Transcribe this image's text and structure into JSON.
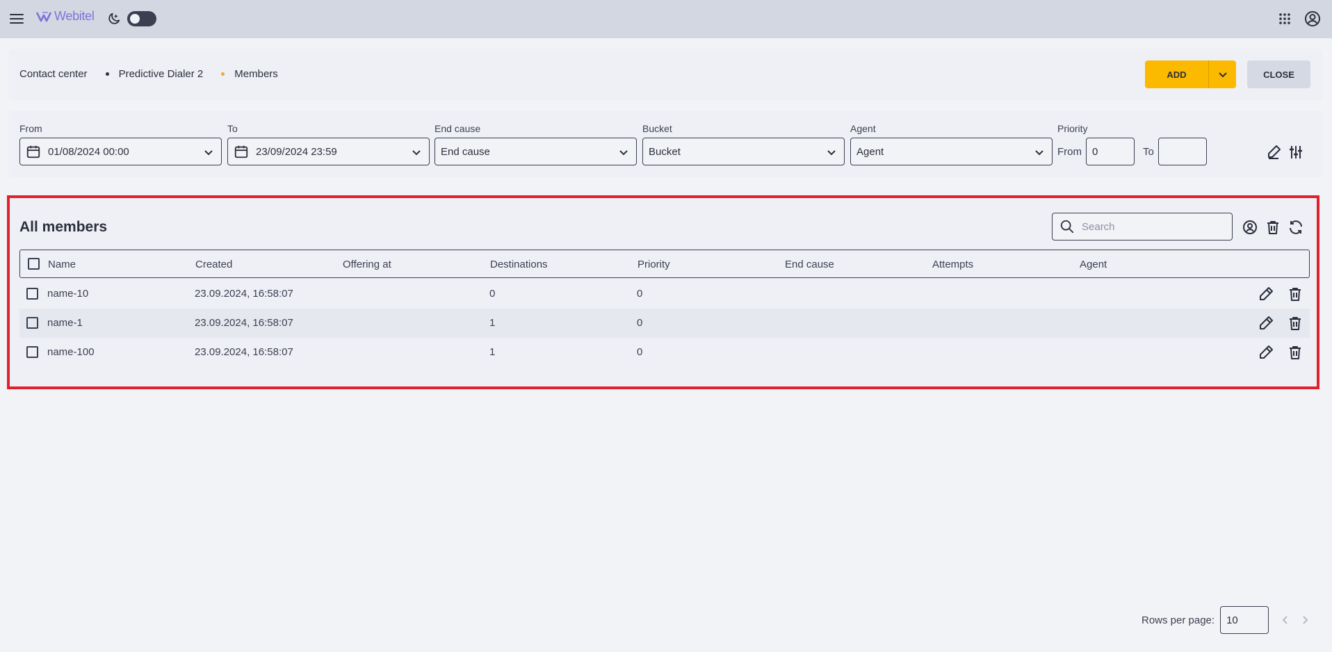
{
  "app": {
    "logo_text": "Webitel"
  },
  "breadcrumb": [
    "Contact center",
    "Predictive Dialer 2",
    "Members"
  ],
  "actions": {
    "add_label": "ADD",
    "close_label": "CLOSE"
  },
  "filters": {
    "from": {
      "label": "From",
      "value": "01/08/2024 00:00"
    },
    "to": {
      "label": "To",
      "value": "23/09/2024 23:59"
    },
    "end_cause": {
      "label": "End cause",
      "value": "End cause"
    },
    "bucket": {
      "label": "Bucket",
      "value": "Bucket"
    },
    "agent": {
      "label": "Agent",
      "value": "Agent"
    },
    "priority": {
      "label": "Priority",
      "from_label": "From",
      "from_value": "0",
      "to_label": "To",
      "to_value": ""
    }
  },
  "members": {
    "title": "All members",
    "search_placeholder": "Search",
    "columns": [
      "Name",
      "Created",
      "Offering at",
      "Destinations",
      "Priority",
      "End cause",
      "Attempts",
      "Agent"
    ],
    "rows": [
      {
        "name": "name-10",
        "created": "23.09.2024, 16:58:07",
        "offering_at": "",
        "destinations": "0",
        "priority": "0",
        "end_cause": "",
        "attempts": "",
        "agent": ""
      },
      {
        "name": "name-1",
        "created": "23.09.2024, 16:58:07",
        "offering_at": "",
        "destinations": "1",
        "priority": "0",
        "end_cause": "",
        "attempts": "",
        "agent": ""
      },
      {
        "name": "name-100",
        "created": "23.09.2024, 16:58:07",
        "offering_at": "",
        "destinations": "1",
        "priority": "0",
        "end_cause": "",
        "attempts": "",
        "agent": ""
      }
    ]
  },
  "pagination": {
    "rows_per_page_label": "Rows per page:",
    "rows_per_page": "10"
  },
  "colors": {
    "accent": "#fbb900",
    "topbar": "#d3d7e2",
    "highlight_border": "#e0212d",
    "logo": "#7b74d9"
  }
}
